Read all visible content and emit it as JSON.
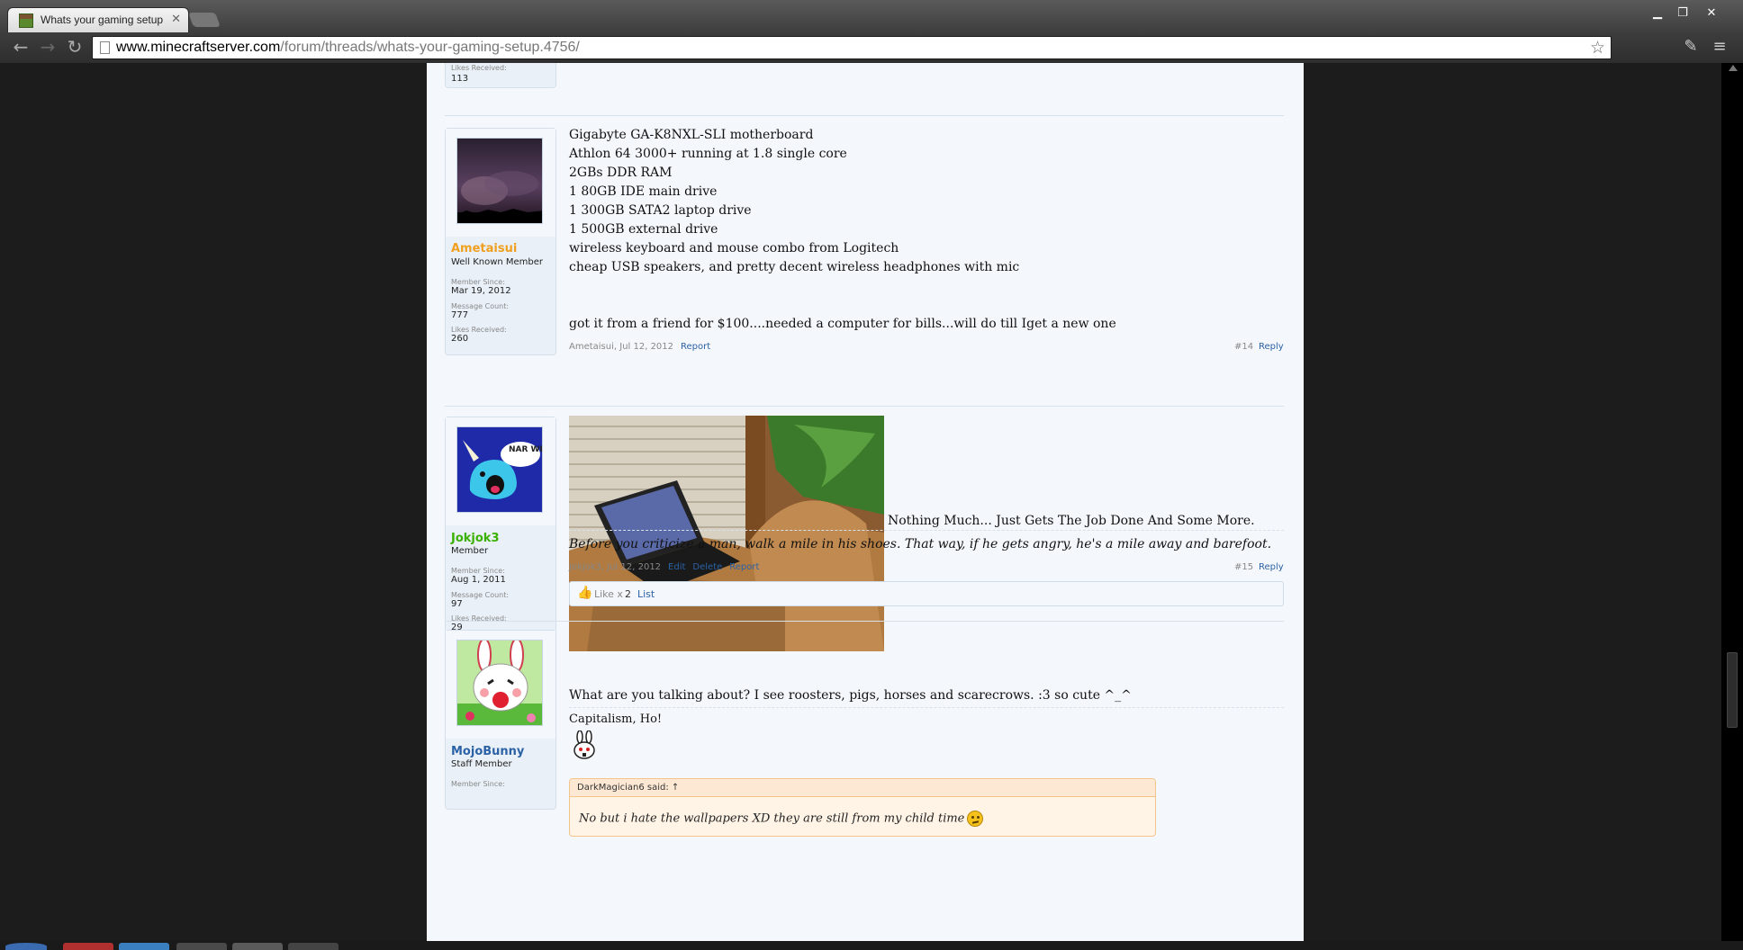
{
  "browser": {
    "tab_title": "Whats your gaming setup",
    "url_host": "www.minecraftserver.com",
    "url_path": "/forum/threads/whats-your-gaming-setup.4756/"
  },
  "prev_post": {
    "likes_label": "Likes Received:",
    "likes_value": "113"
  },
  "posts": [
    {
      "username": "Ametaisui",
      "user_title": "Well Known Member",
      "member_since_label": "Member Since:",
      "member_since": "Mar 19, 2012",
      "message_count_label": "Message Count:",
      "message_count": "777",
      "likes_label": "Likes Received:",
      "likes": "260",
      "lines": [
        "Gigabyte GA-K8NXL-SLI motherboard",
        "Athlon 64 3000+ running at 1.8 single core",
        "2GBs DDR RAM",
        "1 80GB IDE main drive",
        "1 300GB SATA2 laptop drive",
        "1 500GB external drive",
        "wireless keyboard and mouse combo from Logitech",
        "cheap USB speakers, and pretty decent wireless headphones with mic",
        "got it from a friend for $100....needed a computer for bills...will do till Iget a new one"
      ],
      "meta": "Ametaisui, Jul 12, 2012",
      "report": "Report",
      "number": "#14",
      "reply": "Reply"
    },
    {
      "username": "Jokjok3",
      "user_title": "Member",
      "member_since_label": "Member Since:",
      "member_since": "Aug 1, 2011",
      "message_count_label": "Message Count:",
      "message_count": "97",
      "likes_label": "Likes Received:",
      "likes": "29",
      "avatar_text": "NAR WHAL!",
      "caption": "Nothing Much... Just Gets The Job Done And Some More.",
      "signature": "Before you criticize a man, walk a mile in his shoes. That way, if he gets angry, he's a mile away and barefoot.",
      "meta": "Jokjok3, Jul 12, 2012",
      "edit": "Edit",
      "delete": "Delete",
      "report": "Report",
      "number": "#15",
      "reply": "Reply",
      "like_text": "Like x",
      "like_count": "2",
      "like_list": "List"
    },
    {
      "username": "MojoBunny",
      "user_title": "Staff Member",
      "member_since_label": "Member Since:",
      "quote_author": "DarkMagician6 said: ↑",
      "quote_text": "No but i hate the wallpapers XD they are still from my child time",
      "message": "What are you talking about? I see roosters, pigs, horses and scarecrows. :3 so cute ^_^",
      "signature": "Capitalism, Ho!"
    }
  ],
  "colors": {
    "username_orange": "#f0a020",
    "username_green": "#3ab000",
    "username_blue": "#2b62a6",
    "link": "#2b62a6"
  }
}
